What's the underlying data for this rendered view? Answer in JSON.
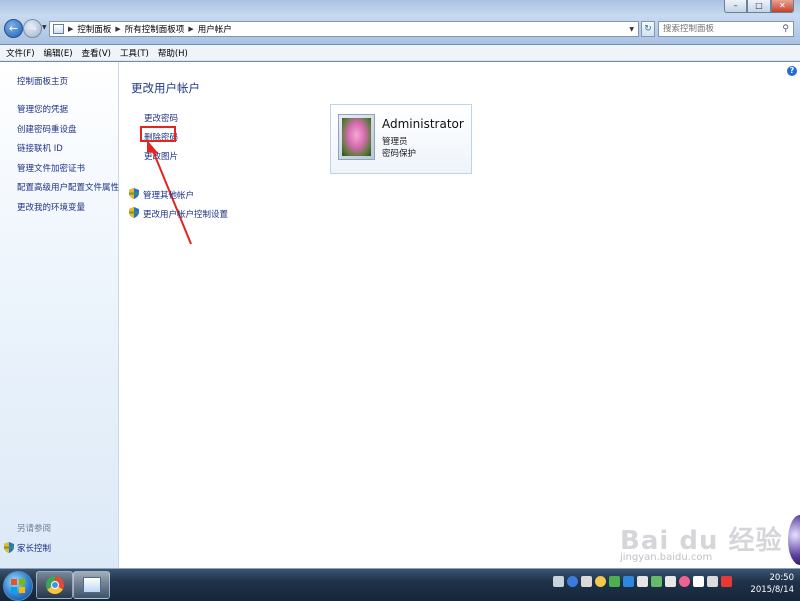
{
  "window": {
    "controls": {
      "minimize": "–",
      "maximize": "□",
      "close": "✕"
    }
  },
  "navigation": {
    "back_icon": "back-arrow-icon",
    "forward_icon": "forward-arrow-icon",
    "breadcrumbs": [
      "控制面板",
      "所有控制面板项",
      "用户帐户"
    ],
    "search_placeholder": "搜索控制面板"
  },
  "menu": {
    "items": [
      "文件(F)",
      "编辑(E)",
      "查看(V)",
      "工具(T)",
      "帮助(H)"
    ]
  },
  "sidebar": {
    "home": "控制面板主页",
    "links": [
      "管理您的凭据",
      "创建密码重设盘",
      "链接联机 ID",
      "管理文件加密证书",
      "配置高级用户配置文件属性",
      "更改我的环境变量"
    ],
    "see_also": "另请参阅",
    "parental_controls": "家长控制"
  },
  "main": {
    "title": "更改用户帐户",
    "tasks": [
      "更改密码",
      "删除密码",
      "更改图片"
    ],
    "shield_tasks": [
      "管理其他帐户",
      "更改用户帐户控制设置"
    ]
  },
  "account": {
    "name": "Administrator",
    "role": "管理员",
    "status": "密码保护"
  },
  "watermark": {
    "logo": "Bai du 经验",
    "url": "jingyan.baidu.com"
  },
  "taskbar": {
    "time": "20:50",
    "date": "2015/8/14"
  },
  "colors": {
    "link": "#1e3287",
    "title": "#1e3b8a",
    "highlight": "#e0261f"
  }
}
